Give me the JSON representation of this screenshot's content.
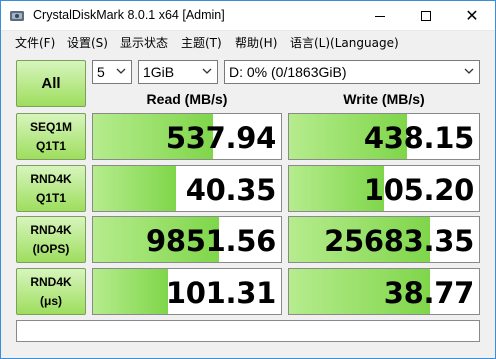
{
  "window": {
    "title": "CrystalDiskMark 8.0.1 x64 [Admin]"
  },
  "menu": [
    {
      "label": "文件(F)"
    },
    {
      "label": "设置(S)"
    },
    {
      "label": "显示状态"
    },
    {
      "label": "主题(T)"
    },
    {
      "label": "帮助(H)"
    },
    {
      "label": "语言(L)(Language)"
    }
  ],
  "controls": {
    "all_label": "All",
    "count_value": "5",
    "size_value": "1GiB",
    "drive_value": "D: 0% (0/1863GiB)"
  },
  "headers": {
    "read": "Read (MB/s)",
    "write": "Write (MB/s)"
  },
  "rows": [
    {
      "line1": "SEQ1M",
      "line2": "Q1T1",
      "read": "537.94",
      "write": "438.15",
      "read_fill": 0.64,
      "write_fill": 0.62
    },
    {
      "line1": "RND4K",
      "line2": "Q1T1",
      "read": "40.35",
      "write": "105.20",
      "read_fill": 0.44,
      "write_fill": 0.5
    },
    {
      "line1": "RND4K",
      "line2": "(IOPS)",
      "read": "9851.56",
      "write": "25683.35",
      "read_fill": 0.67,
      "write_fill": 0.74
    },
    {
      "line1": "RND4K",
      "line2": "(μs)",
      "read": "101.31",
      "write": "38.77",
      "read_fill": 0.4,
      "write_fill": 0.74
    }
  ],
  "comment": "",
  "colors": {
    "accent": "#3c8fd6",
    "button_green_top": "#d7f5bd",
    "button_green_bottom": "#9ede5e",
    "bar_green": "#7fd64a"
  }
}
